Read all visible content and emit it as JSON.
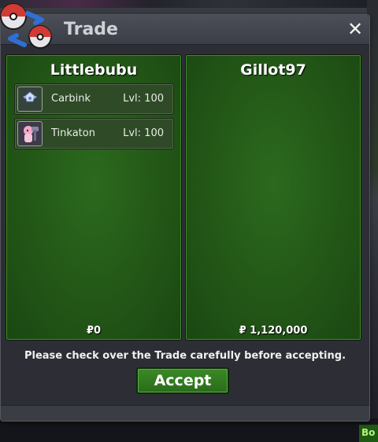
{
  "window": {
    "title": "Trade",
    "close_label": "✕"
  },
  "left_panel": {
    "player": "Littlebubu",
    "items": [
      {
        "name": "Carbink",
        "level": "Lvl: 100",
        "icon": "carbink-icon"
      },
      {
        "name": "Tinkaton",
        "level": "Lvl: 100",
        "icon": "tinkaton-icon"
      }
    ],
    "money": "₽0"
  },
  "right_panel": {
    "player": "Gillot97",
    "items": [],
    "money": "₽ 1,120,000"
  },
  "notice": "Please check over the Trade carefully before accepting.",
  "accept_label": "Accept",
  "background": {
    "corner_text": "Bo"
  },
  "colors": {
    "panel_green": "#245a18",
    "window_bg": "#2d2e35",
    "accept_green": "#3a8a25"
  }
}
